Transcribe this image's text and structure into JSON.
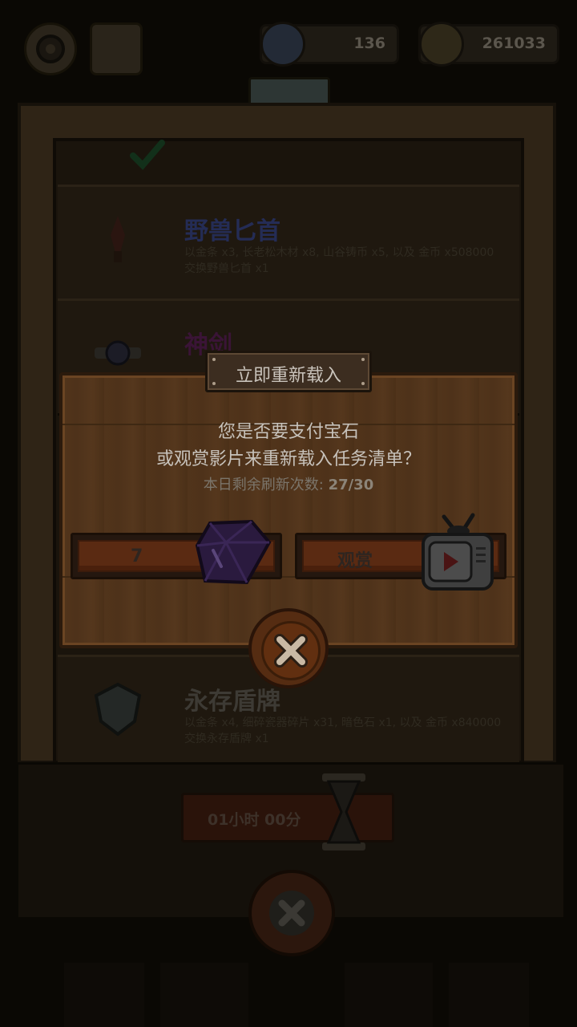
{
  "hud": {
    "gems": "136",
    "coins": "261033"
  },
  "task_list": {
    "items": [
      {
        "name": "野兽匕首",
        "desc": "以金条 x3, 长老松木材 x8, 山谷铸币 x5, 以及 金币 x508000交换野兽匕首 x1"
      },
      {
        "name": "神剑",
        "desc": ""
      },
      {
        "name": "永存盾牌",
        "desc": "以金条 x4, 细碎瓷器碎片 x31, 暗色石 x1, 以及 金币 x840000交换永存盾牌 x1"
      }
    ]
  },
  "timer": {
    "text": "01小时 00分"
  },
  "dialog": {
    "title": "立即重新载入",
    "question_line1": "您是否要支付宝石",
    "question_line2": "或观赏影片来重新载入任务清单？",
    "refresh_label": "本日剩余刷新次数: ",
    "refresh_count": "27/30",
    "gem_button_cost": "7",
    "watch_button_label": "观赏"
  },
  "icons": {
    "gem": "gem-icon",
    "tv": "tv-play-icon",
    "close": "close-icon",
    "hourglass": "hourglass-icon",
    "settings": "gear-icon",
    "book": "book-icon",
    "coin": "coin-icon"
  },
  "colors": {
    "dialog_wood": "#51341b",
    "button_orange": "#5a2a12",
    "gem_purple": "#5c3c8a",
    "close_x": "#c9b9a4"
  }
}
